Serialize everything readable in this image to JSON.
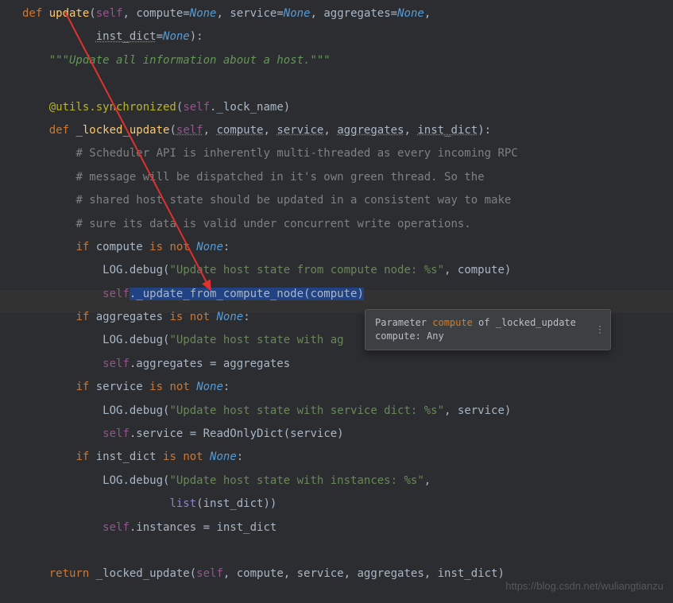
{
  "code": {
    "line1": {
      "def": "def ",
      "fn": "update",
      "open": "(",
      "self": "self",
      "c1": ", ",
      "p1": "compute",
      "eq1": "=",
      "n1": "None",
      "c2": ", ",
      "p2": "service",
      "eq2": "=",
      "n2": "None",
      "c3": ", ",
      "p3": "aggregates",
      "eq3": "=",
      "n3": "None",
      "c4": ","
    },
    "line2": {
      "pad": "           ",
      "p4": "inst_dict",
      "eq4": "=",
      "n4": "None",
      "close": "):"
    },
    "line3": {
      "pad": "    ",
      "doc": "\"\"\"Update all information about a host.\"\"\""
    },
    "line5": {
      "pad": "    ",
      "dec": "@utils.synchronized",
      "open": "(",
      "self": "self",
      "dot": "._lock_name",
      "close": ")"
    },
    "line6": {
      "pad": "    ",
      "def": "def ",
      "fn": "_locked_update",
      "open": "(",
      "self": "self",
      "c1": ", ",
      "p1": "compute",
      "c2": ", ",
      "p2": "service",
      "c3": ", ",
      "p3": "aggregates",
      "c4": ", ",
      "p4": "inst_dict",
      "close": "):"
    },
    "line7": {
      "pad": "        ",
      "c": "# Scheduler API is inherently multi-threaded as every incoming RPC"
    },
    "line8": {
      "pad": "        ",
      "c": "# message will be dispatched in it's own green thread. So the"
    },
    "line9": {
      "pad": "        ",
      "c": "# shared host state should be updated in a consistent way to make"
    },
    "line10": {
      "pad": "        ",
      "c": "# sure its data is valid under concurrent write operations."
    },
    "line11": {
      "pad": "        ",
      "if": "if ",
      "v": "compute ",
      "is": "is not ",
      "none": "None",
      "colon": ":"
    },
    "line12": {
      "pad": "            ",
      "log": "LOG.debug(",
      "str": "\"Update host state from compute node: %s\"",
      "c": ", compute",
      "close": ")"
    },
    "line13": {
      "pad": "            ",
      "self": "self",
      "method": "._update_from_compute_node(",
      "arg": "compute",
      "close": ")"
    },
    "line14": {
      "pad": "        ",
      "if": "if ",
      "v": "aggregates ",
      "is": "is not ",
      "none": "None",
      "colon": ":"
    },
    "line15": {
      "pad": "            ",
      "log": "LOG.debug(",
      "str": "\"Update host state with ag"
    },
    "line16": {
      "pad": "            ",
      "self": "self",
      "dot": ".aggregates = aggregates"
    },
    "line17": {
      "pad": "        ",
      "if": "if ",
      "v": "service ",
      "is": "is not ",
      "none": "None",
      "colon": ":"
    },
    "line18": {
      "pad": "            ",
      "log": "LOG.debug(",
      "str": "\"Update host state with service dict: %s\"",
      "c": ", service",
      "close": ")"
    },
    "line19": {
      "pad": "            ",
      "self": "self",
      "dot": ".service = ",
      "ro": "ReadOnlyDict",
      "args": "(service)"
    },
    "line20": {
      "pad": "        ",
      "if": "if ",
      "v": "inst_dict ",
      "is": "is not ",
      "none": "None",
      "colon": ":"
    },
    "line21": {
      "pad": "            ",
      "log": "LOG.debug(",
      "str": "\"Update host state with instances: %s\"",
      "c": ","
    },
    "line22": {
      "pad": "                      ",
      "list": "list",
      "args": "(inst_dict))"
    },
    "line23": {
      "pad": "            ",
      "self": "self",
      "dot": ".instances = inst_dict"
    },
    "line25": {
      "pad": "    ",
      "ret": "return ",
      "fn": "_locked_update(",
      "self": "self",
      "args": ", compute, service, aggregates, inst_dict)"
    }
  },
  "tooltip": {
    "line1_pre": "Parameter ",
    "line1_param": "compute",
    "line1_post": " of _locked_update",
    "line2": "compute: Any",
    "more": "⋮"
  },
  "watermark": "https://blog.csdn.net/wuliangtianzu"
}
